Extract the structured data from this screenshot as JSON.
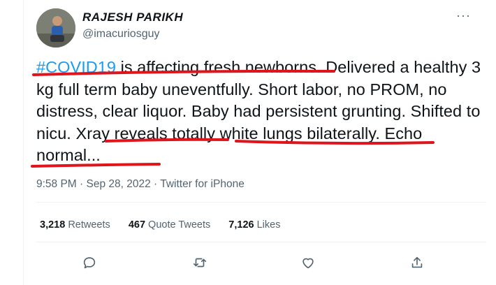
{
  "tweet": {
    "author_name": "RAJESH PARIKH",
    "author_handle": "@imacuriosguy",
    "more_icon": "more-options-icon",
    "text": {
      "hashtag": "#COVID19",
      "p1": " is affecting fresh newborns. Delivered a healthy 3 kg full term baby uneventfully. Short labor, no PROM, no distress, clear liquor. Baby had persistent grunting. Shifted to nicu. Xray reveals totally white lungs bilaterally. Echo normal..."
    },
    "timestamp": "9:58 PM · Sep 28, 2022 · Twitter for iPhone"
  },
  "stats": {
    "retweets_count": "3,218",
    "retweets_label": "Retweets",
    "quotes_count": "467",
    "quotes_label": "Quote Tweets",
    "likes_count": "7,126",
    "likes_label": "Likes"
  },
  "actions": {
    "reply_icon": "reply-icon",
    "retweet_icon": "retweet-icon",
    "like_icon": "like-icon",
    "share_icon": "share-icon"
  },
  "colors": {
    "hashtag": "#1d9bf0",
    "underline": "#e0141c",
    "secondary_text": "#536471"
  }
}
